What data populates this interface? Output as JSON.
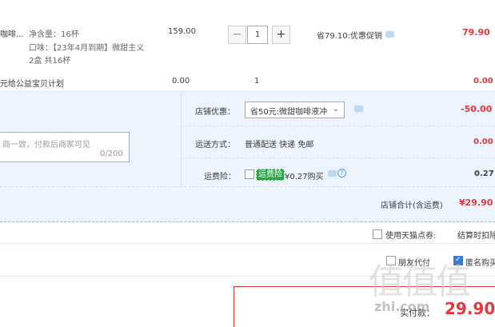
{
  "item": {
    "name_fragment": "咖啡...",
    "spec_line1": "净含量：16杯",
    "spec_line2": "口味：【23年4月到期】微甜主义",
    "spec_line3": "2盒 共16杯",
    "price": "159.00",
    "qty_minus": "−",
    "qty_value": "1",
    "qty_plus": "+",
    "promo": "省79.10:优惠促销",
    "subtotal": "79.90"
  },
  "charity": {
    "label": "元给公益宝贝计划",
    "price": "0.00",
    "qty": "1",
    "subtotal": "0.00"
  },
  "shop": {
    "discount_label": "店铺优惠：",
    "discount_select": "省50元:微甜咖啡液冲",
    "discount_amount": "-50.00",
    "message_placeholder": "商一致，付款后商家可见",
    "message_count": "0/200",
    "shipping_label": "运送方式：",
    "shipping_value": "普通配送 快递 免邮",
    "shipping_amount": "0.00",
    "insurance_label": "运费险：",
    "insurance_tag": "运费险",
    "insurance_price": "¥0.27购买",
    "insurance_amount": "0.27",
    "total_label": "店铺合计(含运费)",
    "total_amount": "¥29.90"
  },
  "options": {
    "tmall_points": "使用天猫点券:",
    "settle_text": "结算时扣除",
    "anonymous": "匿名购买",
    "friend_pay": "朋友代付"
  },
  "payment": {
    "label": "实付款：",
    "amount": "29.90"
  },
  "watermark": {
    "logo": "值值值",
    "site": "zhi.com"
  },
  "colors": {
    "accent_red": "#e4393c",
    "panel_blue": "#edf4fd",
    "tag_green": "#2fa24a"
  }
}
